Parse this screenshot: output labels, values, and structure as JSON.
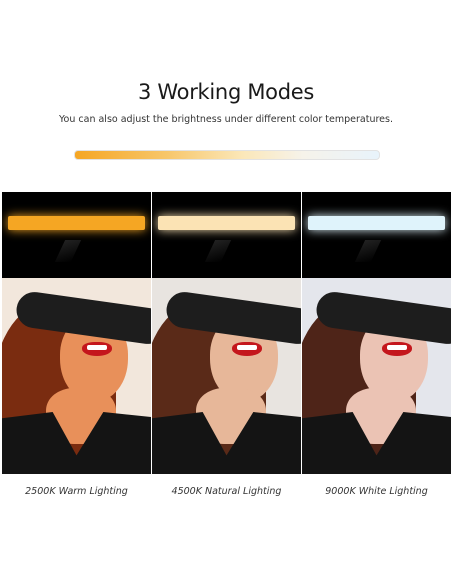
{
  "header": {
    "title": "3 Working Modes",
    "subtitle": "You can also adjust the brightness under different color temperatures."
  },
  "modes": [
    {
      "label": "2500K Warm Lighting",
      "lamp_color": "#f5a623",
      "wall": "#f2e7dc",
      "skin": "#e8905a",
      "hair": "#7a2c10"
    },
    {
      "label": "4500K Natural Lighting",
      "lamp_color": "#fbe3b4",
      "wall": "#e8e4e0",
      "skin": "#e7b799",
      "hair": "#5a2a18"
    },
    {
      "label": "9000K White Lighting",
      "lamp_color": "#dff3fb",
      "wall": "#e4e6ec",
      "skin": "#ebc3b4",
      "hair": "#4e2418"
    }
  ]
}
